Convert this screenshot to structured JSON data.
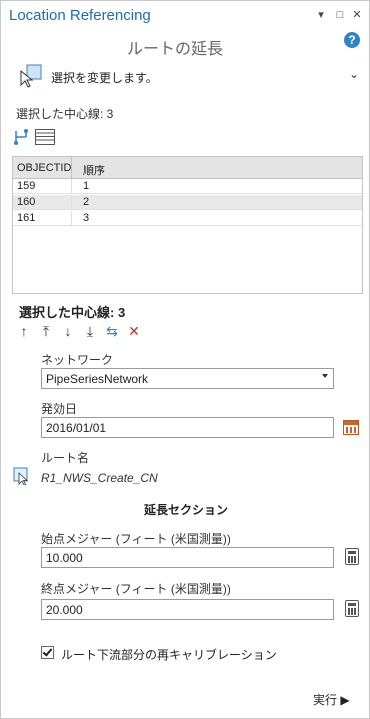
{
  "window": {
    "title": "Location Referencing",
    "controls": {
      "dropdown": "▾",
      "restore": "□",
      "close": "✕"
    },
    "subtitle": "ルートの延長",
    "help": "?"
  },
  "selection": {
    "tool_label": "選択を変更します。",
    "selected_count_label": "選択した中心線: 3"
  },
  "table": {
    "columns": [
      "OBJECTID",
      "順序"
    ],
    "rows": [
      {
        "objectid": "159",
        "order": "1"
      },
      {
        "objectid": "160",
        "order": "2"
      },
      {
        "objectid": "161",
        "order": "3"
      }
    ]
  },
  "ordering": {
    "label": "選択した中心線: 3",
    "tools": [
      "arrow-up-icon",
      "arrow-to-top-icon",
      "arrow-down-icon",
      "arrow-to-bottom-icon",
      "reverse-icon",
      "remove-icon"
    ]
  },
  "form": {
    "network_label": "ネットワーク",
    "network_value": "PipeSeriesNetwork",
    "effective_date_label": "発効日",
    "effective_date_value": "2016/01/01",
    "route_name_label": "ルート名",
    "route_name_value": "R1_NWS_Create_CN",
    "section_title": "延長セクション",
    "from_measure_label": "始点メジャー (フィート (米国測量))",
    "from_measure_value": "10.000",
    "to_measure_label": "終点メジャー (フィート (米国測量))",
    "to_measure_value": "20.000",
    "recalibrate_label": "ルート下流部分の再キャリブレーション",
    "recalibrate_checked": true
  },
  "footer": {
    "run_label": "実行 ▶"
  },
  "colors": {
    "title": "#1a6fb0",
    "help": "#2f84c9",
    "remove": "#d0312d",
    "reverse": "#2f84c9"
  }
}
